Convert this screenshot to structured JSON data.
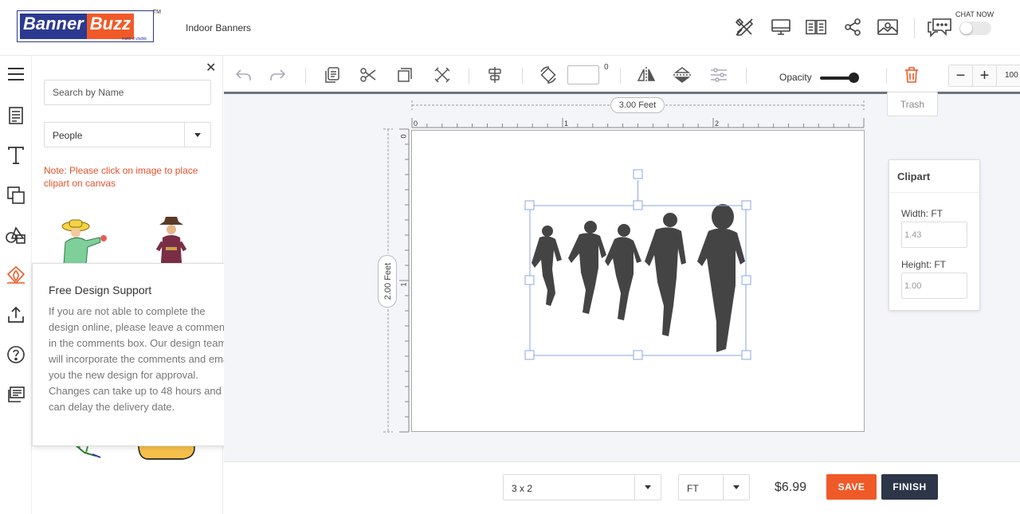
{
  "header": {
    "logo_part1": "Banner",
    "logo_part2": "Buzz",
    "logo_tagline": "make it visible",
    "logo_tm": "TM",
    "product_title": "Indoor Banners",
    "icons": [
      "tools-icon",
      "monitor-icon",
      "book-icon",
      "share-icon",
      "image-icon",
      "chat-icon"
    ],
    "chat_label": "CHAT NOW",
    "chat_enabled": false
  },
  "rail": {
    "icons": [
      "menu-icon",
      "document-icon",
      "text-icon",
      "layers-icon",
      "shapes-icon",
      "clipart-icon",
      "upload-icon",
      "help-icon",
      "comments-icon"
    ],
    "active": "clipart-icon"
  },
  "panel": {
    "search_placeholder": "Search by Name",
    "category_value": "People",
    "note": "Note: Please click on image to place clipart on canvas"
  },
  "support_popup": {
    "title": "Free Design Support",
    "body": "If you are not able to complete the design online, please leave a comments in the comments box. Our design team will incorporate the comments and email you the new design for approval. Changes can take up to 48 hours and can delay the delivery date."
  },
  "toolbar": {
    "rotation_degree_symbol": "0",
    "opacity_label": "Opacity",
    "opacity_value": 1.0,
    "zoom_value": "100",
    "trash_tooltip": "Trash"
  },
  "canvas": {
    "width_label": "3.00 Feet",
    "height_label": "2.00 Feet",
    "ruler_x": [
      "0",
      "1",
      "2"
    ],
    "ruler_y": [
      "0",
      "1"
    ]
  },
  "properties": {
    "title": "Clipart",
    "width_label": "Width: FT",
    "width_value": "1.43",
    "height_label": "Height: FT",
    "height_value": "1.00"
  },
  "bottom": {
    "size_value": "3 x 2",
    "unit_value": "FT",
    "price": "$6.99",
    "save_label": "SAVE",
    "finish_label": "FINISH"
  },
  "colors": {
    "brand_blue": "#2b3990",
    "brand_orange": "#f05a28",
    "finish_dark": "#2d3548",
    "note_red": "#e8502a"
  }
}
